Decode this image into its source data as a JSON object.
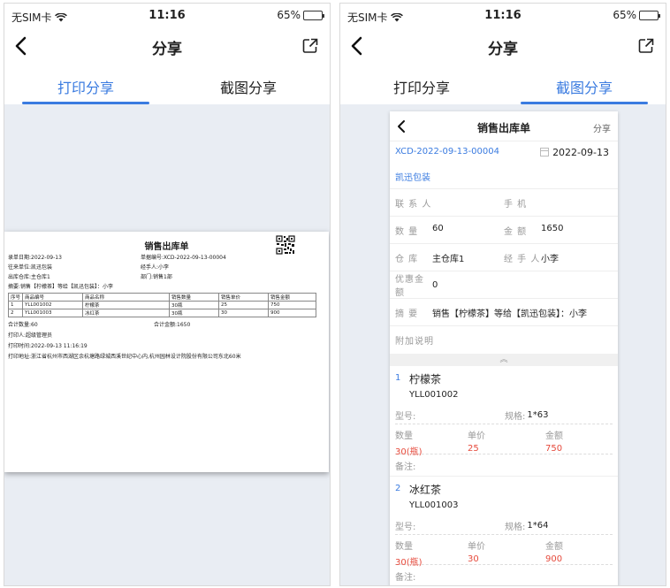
{
  "status": {
    "carrier": "无SIM卡",
    "time": "11:16",
    "battery": "65%",
    "battery_level": 0.65
  },
  "nav": {
    "title": "分享"
  },
  "tabs": [
    {
      "label": "打印分享"
    },
    {
      "label": "截图分享"
    }
  ],
  "left_active_tab": 0,
  "right_active_tab": 1,
  "print_preview": {
    "title": "销售出库单",
    "date": "录单日期:2022-09-13",
    "doc_no": "单据编号:XCD-2022-09-13-00004",
    "customer": "往来单位:凯迅包装",
    "handler": "经手人:小李",
    "warehouse": "出库仓库:主仓库1",
    "department": "部门:销售1部",
    "summary": "摘要:销售【柠檬茶】等给【凯迅包装】：小李",
    "table_headers": [
      "序号",
      "商品编号",
      "商品名称",
      "销售数量",
      "销售单价",
      "销售金额"
    ],
    "table_rows": [
      [
        "1",
        "YLL001002",
        "柠檬茶",
        "30瓶",
        "25",
        "750"
      ],
      [
        "2",
        "YLL001003",
        "冰红茶",
        "30瓶",
        "30",
        "900"
      ]
    ],
    "total_qty": "合计数量:60",
    "total_amount": "合计金额:1650",
    "printer": "打印人:超级管理员",
    "print_time": "打印时间:2022-09-13 11:16:19",
    "print_address": "打印地址:浙江省杭州市西湖区余杭塘路绿城西溪世纪中心内,杭州园林设计院股份有限公司东北60米"
  },
  "screenshot_card": {
    "title": "销售出库单",
    "share": "分享",
    "doc_no": "XCD-2022-09-13-00004",
    "date": "2022-09-13",
    "customer": "凯迅包装",
    "contact_label": "联 系 人",
    "phone_label": "手 机",
    "qty_label": "数 量",
    "qty_value": "60",
    "amount_label": "金 额",
    "amount_value": "1650",
    "warehouse_label": "仓 库",
    "warehouse_value": "主仓库1",
    "handler_label": "经 手 人",
    "handler_value": "小李",
    "discount_label": "优惠金额",
    "discount_value": "0",
    "summary_label": "摘 要",
    "summary_value": "销售【柠檬茶】等给【凯迅包装】：小李",
    "extra_label": "附加说明",
    "collapse_glyph": "︽",
    "items": [
      {
        "index": "1",
        "name": "柠檬茶",
        "code": "YLL001002",
        "model_label": "型号:",
        "spec_label": "规格:",
        "spec_value": "1*63",
        "qty_label": "数量",
        "price_label": "单价",
        "amount_label": "金额",
        "qty": "30(瓶)",
        "price": "25",
        "amount": "750",
        "note_label": "备注:"
      },
      {
        "index": "2",
        "name": "冰红茶",
        "code": "YLL001003",
        "model_label": "型号:",
        "spec_label": "规格:",
        "spec_value": "1*64",
        "qty_label": "数量",
        "price_label": "单价",
        "amount_label": "金额",
        "qty": "30(瓶)",
        "price": "30",
        "amount": "900",
        "note_label": "备注:"
      }
    ]
  },
  "colors": {
    "accent": "#3a7be0",
    "red_value": "#e64a3c",
    "background_gray": "#e9edf3"
  }
}
